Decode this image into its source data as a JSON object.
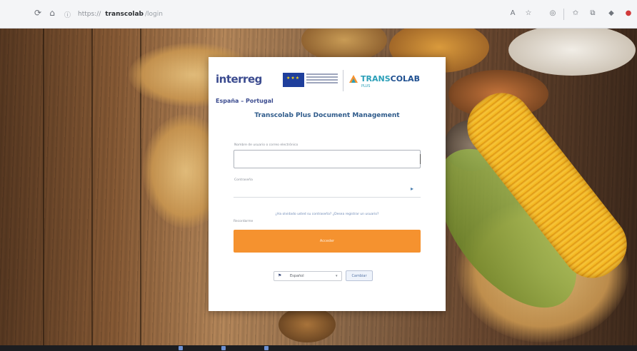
{
  "browser": {
    "url_domain": "transcolab",
    "url_prefix": "https://",
    "url_path": "/login",
    "icons": {
      "back": "arrow-left-icon",
      "reload": "reload-icon",
      "home": "home-icon"
    }
  },
  "card": {
    "logo": {
      "interreg": "interreg",
      "region": "España – Portugal",
      "transcolab": "TRANS",
      "transcolab_strong": "COLAB",
      "transcolab_sub": "PLUS"
    },
    "title": "Transcolab Plus Document Management",
    "username_label": "Nombre de usuario o correo electrónico",
    "username_value": "",
    "password_label": "Contraseña",
    "forgot_link": "¿Ha olvidado usted su contraseña? ¿Desea registrar un usuario?",
    "remember_label": "Recordarme",
    "login_button": "Acceder",
    "language": {
      "selected": "Español",
      "change_button": "Cambiar"
    }
  },
  "colors": {
    "accent_orange": "#f5922f",
    "title_blue": "#2e5a8a",
    "interreg_blue": "#3b4b8f"
  }
}
